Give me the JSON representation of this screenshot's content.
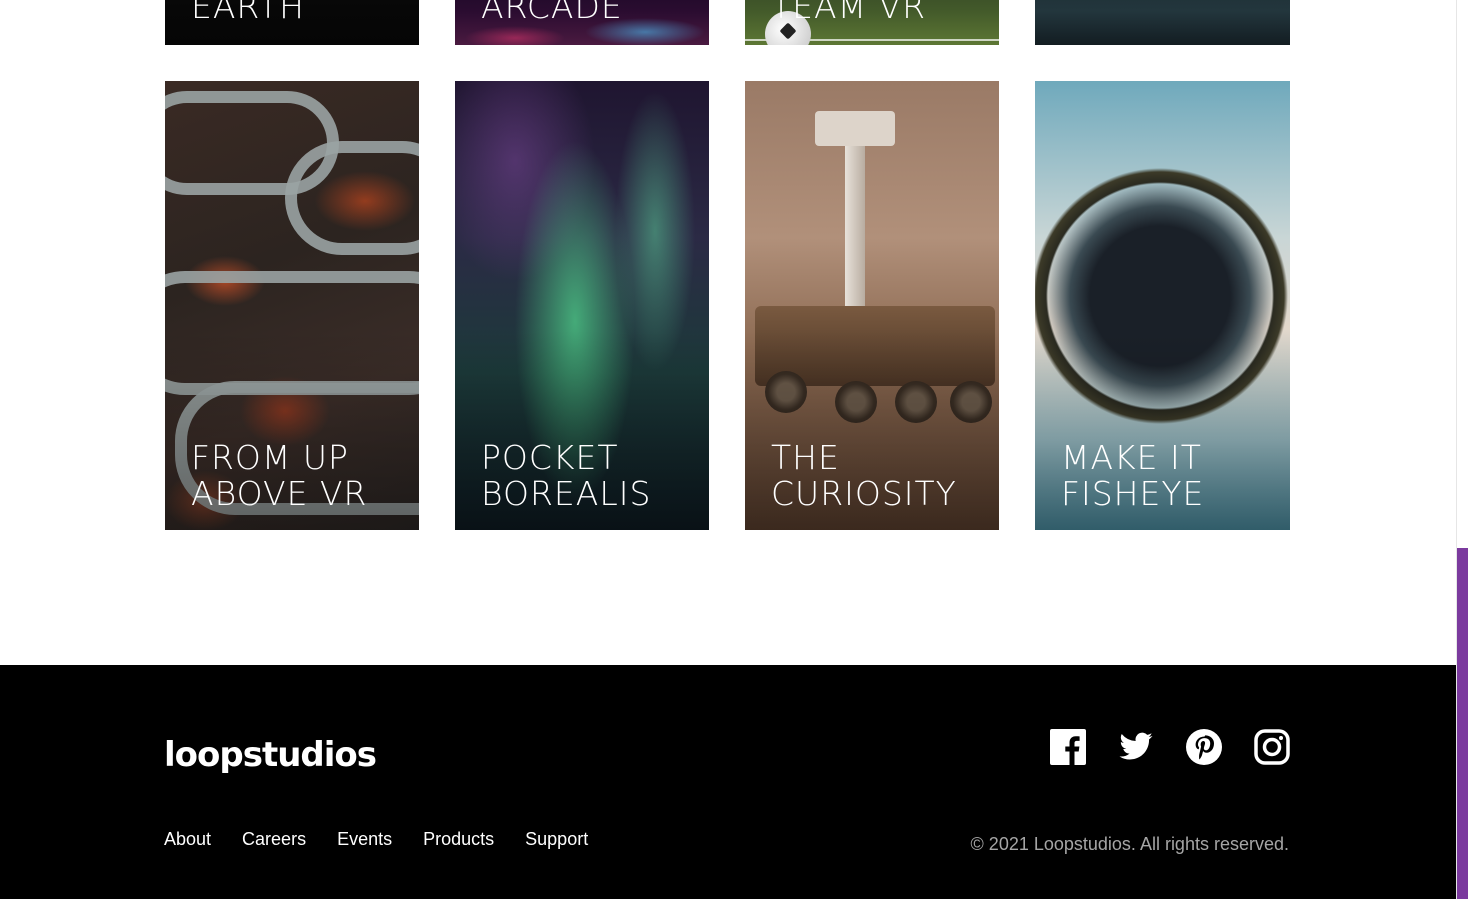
{
  "gallery": {
    "top_row": [
      {
        "title": "EARTH"
      },
      {
        "title": "ARCADE"
      },
      {
        "title": "TEAM VR"
      },
      {
        "title": ""
      }
    ],
    "bottom_row": [
      {
        "title": "FROM UP\nABOVE VR"
      },
      {
        "title": "POCKET\nBOREALIS"
      },
      {
        "title": "THE\nCURIOSITY"
      },
      {
        "title": "MAKE IT\nFISHEYE"
      }
    ]
  },
  "footer": {
    "logo": "loopstudios",
    "nav": [
      "About",
      "Careers",
      "Events",
      "Products",
      "Support"
    ],
    "social": [
      "facebook-icon",
      "twitter-icon",
      "pinterest-icon",
      "instagram-icon"
    ],
    "copyright": "© 2021 Loopstudios. All rights reserved."
  },
  "colors": {
    "footer_bg": "#000000",
    "scroll_thumb": "#7b3a9e"
  }
}
